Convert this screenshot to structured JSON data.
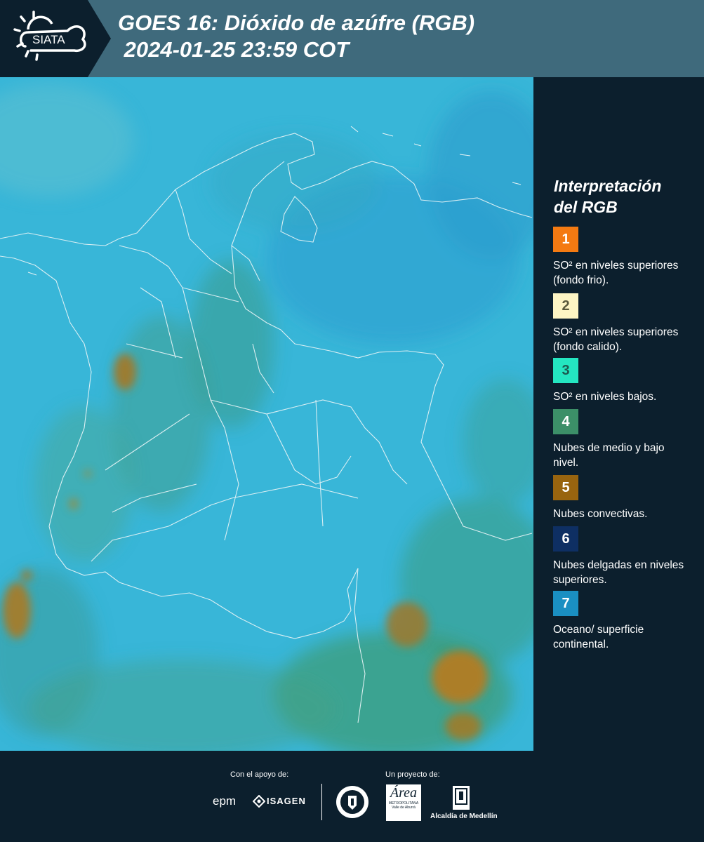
{
  "header": {
    "logo_text": "SIATA",
    "title_line1": "GOES 16: Dióxido de azúfre (RGB)",
    "title_line2": " 2024-01-25 23:59 COT"
  },
  "legend": {
    "title_line1": "Interpretación",
    "title_line2": "del RGB",
    "items": [
      {
        "num": "1",
        "label": "SO² en niveles superiores (fondo frio).",
        "color": "#f47a12",
        "text_color": "#ffffff"
      },
      {
        "num": "2",
        "label": "SO² en niveles superiores (fondo calido).",
        "color": "#fdf5c4",
        "text_color": "#5a5a3c"
      },
      {
        "num": "3",
        "label": "SO² en niveles bajos.",
        "color": "#24e6c1",
        "text_color": "#1c5a50"
      },
      {
        "num": "4",
        "label": "Nubes de medio y bajo nivel.",
        "color": "#3c8f68",
        "text_color": "#ffffff"
      },
      {
        "num": "5",
        "label": "Nubes convectivas.",
        "color": "#98640f",
        "text_color": "#ffffff"
      },
      {
        "num": "6",
        "label": "Nubes delgadas en niveles superiores.",
        "color": "#0e2f63",
        "text_color": "#ffffff"
      },
      {
        "num": "7",
        "label": "Oceano/ superficie continental.",
        "color": "#1a8fc2",
        "text_color": "#ffffff"
      }
    ]
  },
  "footer": {
    "support_label": "Con el apoyo de:",
    "project_label": "Un proyecto de:",
    "epm": "epm",
    "isagen": "ISAGEN",
    "area_label": "Área",
    "area_sub": "METROPOLITANA",
    "area_sub2": "Valle de Aburrá",
    "alcaldia": "Alcaldía de Medellín",
    "medellin_ring": "MEDELLÍN"
  },
  "colors": {
    "header_bg": "#3f6a7c",
    "panel_bg": "#0c1f2d",
    "map_base": "#36b4d6"
  }
}
